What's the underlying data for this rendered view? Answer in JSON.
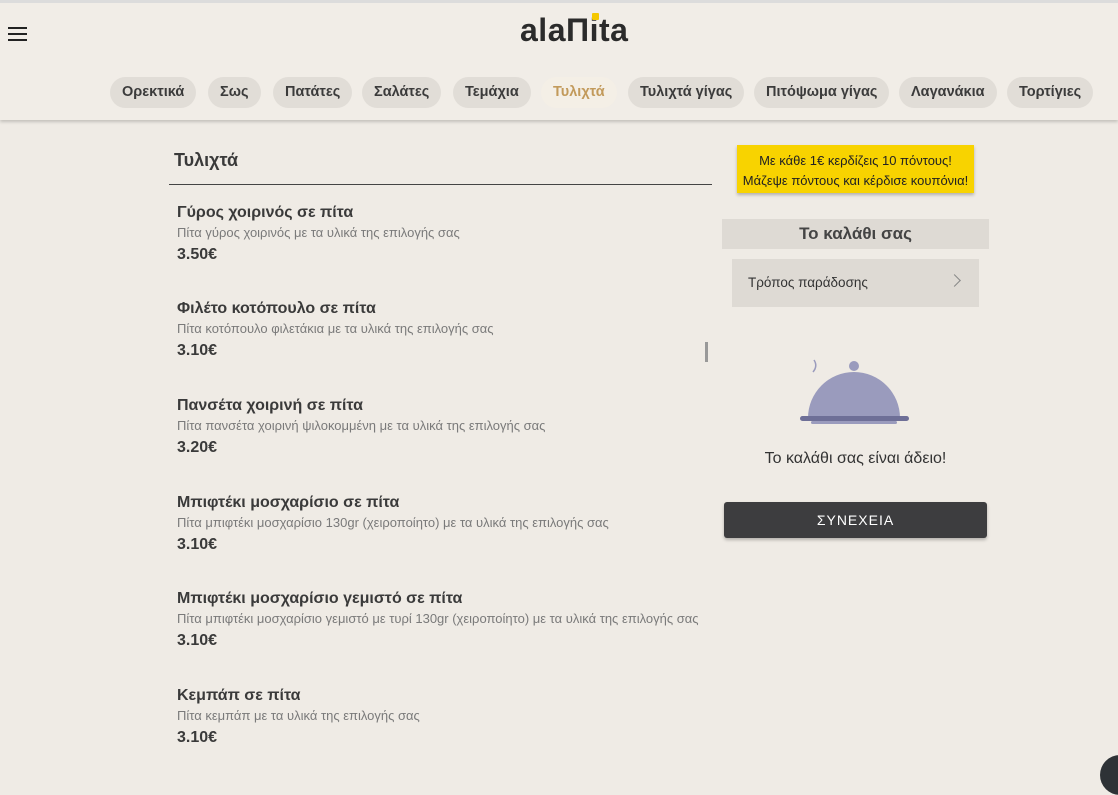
{
  "header": {
    "logo_text": "alaΠita",
    "categories": [
      "Ορεκτικά",
      "Σως",
      "Πατάτες",
      "Σαλάτες",
      "Τεμάχια",
      "Τυλιχτά",
      "Τυλιχτά γίγας",
      "Πιτόψωμα γίγας",
      "Λαγανάκια",
      "Τορτίγιες"
    ],
    "active_category": "Τυλιχτά"
  },
  "section": {
    "title": "Τυλιχτά",
    "items": [
      {
        "name": "Γύρος χοιρινός σε πίτα",
        "desc": "Πίτα γύρος χοιρινός με τα υλικά της επιλογής σας",
        "price": "3.50€"
      },
      {
        "name": "Φιλέτο κοτόπουλο σε πίτα",
        "desc": "Πίτα κοτόπουλο φιλετάκια με τα υλικά της επιλογής σας",
        "price": "3.10€"
      },
      {
        "name": "Πανσέτα χοιρινή σε πίτα",
        "desc": "Πίτα πανσέτα χοιρινή ψιλοκομμένη με τα υλικά της επιλογής σας",
        "price": "3.20€"
      },
      {
        "name": "Μπιφτέκι μοσχαρίσιο σε πίτα",
        "desc": "Πίτα μπιφτέκι μοσχαρίσιο 130gr (χειροποίητο) με τα υλικά της επιλογής σας",
        "price": "3.10€"
      },
      {
        "name": "Μπιφτέκι μοσχαρίσιο γεμιστό σε πίτα",
        "desc": "Πίτα μπιφτέκι μοσχαρίσιο γεμιστό με τυρί 130gr (χειροποίητο) με τα υλικά της επιλογής σας",
        "price": "3.10€"
      },
      {
        "name": "Κεμπάπ σε πίτα",
        "desc": "Πίτα κεμπάπ με τα υλικά της επιλογής σας",
        "price": "3.10€"
      }
    ]
  },
  "promo": {
    "line1": "Με κάθε 1€ κερδίζεις 10 πόντους!",
    "line2": "Μάζεψε πόντους και κέρδισε κουπόνια!"
  },
  "cart": {
    "title": "Το καλάθι σας",
    "delivery_label": "Τρόπος παράδοσης",
    "empty_text": "Το καλάθι σας είναι άδειο!",
    "continue_label": "ΣΥΝΕΧΕΙΑ"
  },
  "colors": {
    "accent_active": "#c29a5b",
    "promo_yellow": "#f8d300",
    "button_dark": "#3d3d3f",
    "cloche": "#9a9bbd"
  }
}
